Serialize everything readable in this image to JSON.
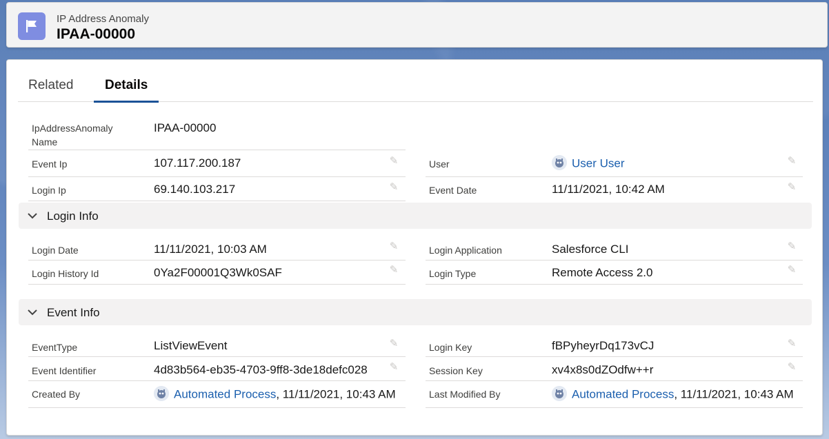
{
  "header": {
    "object_type": "IP Address Anomaly",
    "record_name": "IPAA-00000",
    "icon": "flag-icon"
  },
  "tabs": [
    {
      "label": "Related",
      "active": false
    },
    {
      "label": "Details",
      "active": true
    }
  ],
  "details": {
    "name_label": "IpAddressAnomaly Name",
    "name_value": "IPAA-00000",
    "event_ip_label": "Event Ip",
    "event_ip_value": "107.117.200.187",
    "user_label": "User",
    "user_value": "User User",
    "login_ip_label": "Login Ip",
    "login_ip_value": "69.140.103.217",
    "event_date_label": "Event Date",
    "event_date_value": "11/11/2021, 10:42 AM"
  },
  "login_info": {
    "title": "Login Info",
    "login_date_label": "Login Date",
    "login_date_value": "11/11/2021, 10:03 AM",
    "login_application_label": "Login Application",
    "login_application_value": "Salesforce CLI",
    "login_history_id_label": "Login History Id",
    "login_history_id_value": "0Ya2F00001Q3Wk0SAF",
    "login_type_label": "Login Type",
    "login_type_value": "Remote Access 2.0"
  },
  "event_info": {
    "title": "Event Info",
    "event_type_label": "EventType",
    "event_type_value": "ListViewEvent",
    "login_key_label": "Login Key",
    "login_key_value": "fBPyheyrDq173vCJ",
    "event_identifier_label": "Event Identifier",
    "event_identifier_value": "4d83b564-eb35-4703-9ff8-3de18defc028",
    "session_key_label": "Session Key",
    "session_key_value": "xv4x8s0dZOdfw++r",
    "created_by_label": "Created By",
    "created_by_user": "Automated Process",
    "created_by_date": ", 11/11/2021, 10:43 AM",
    "last_modified_by_label": "Last Modified By",
    "last_modified_by_user": "Automated Process",
    "last_modified_by_date": ", 11/11/2021, 10:43 AM"
  },
  "colors": {
    "brand_icon": "#7f8de1",
    "link": "#1b5fae",
    "active_tab_underline": "#1b5297"
  }
}
